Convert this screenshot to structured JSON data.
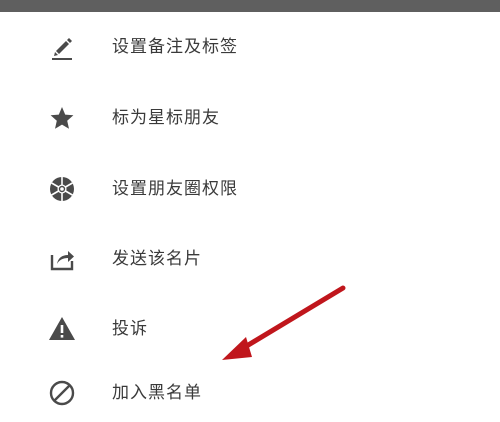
{
  "menu": {
    "items": [
      {
        "label": "设置备注及标签",
        "icon": "edit-pencil-icon"
      },
      {
        "label": "标为星标朋友",
        "icon": "star-icon"
      },
      {
        "label": "设置朋友圈权限",
        "icon": "aperture-icon"
      },
      {
        "label": "发送该名片",
        "icon": "share-card-icon"
      },
      {
        "label": "投诉",
        "icon": "warning-triangle-icon"
      },
      {
        "label": "加入黑名单",
        "icon": "block-icon"
      }
    ]
  },
  "colors": {
    "top_bar": "#5f5f5f",
    "icon": "#4a4a4a",
    "text": "#3a3a3a",
    "arrow": "#c0161c"
  }
}
